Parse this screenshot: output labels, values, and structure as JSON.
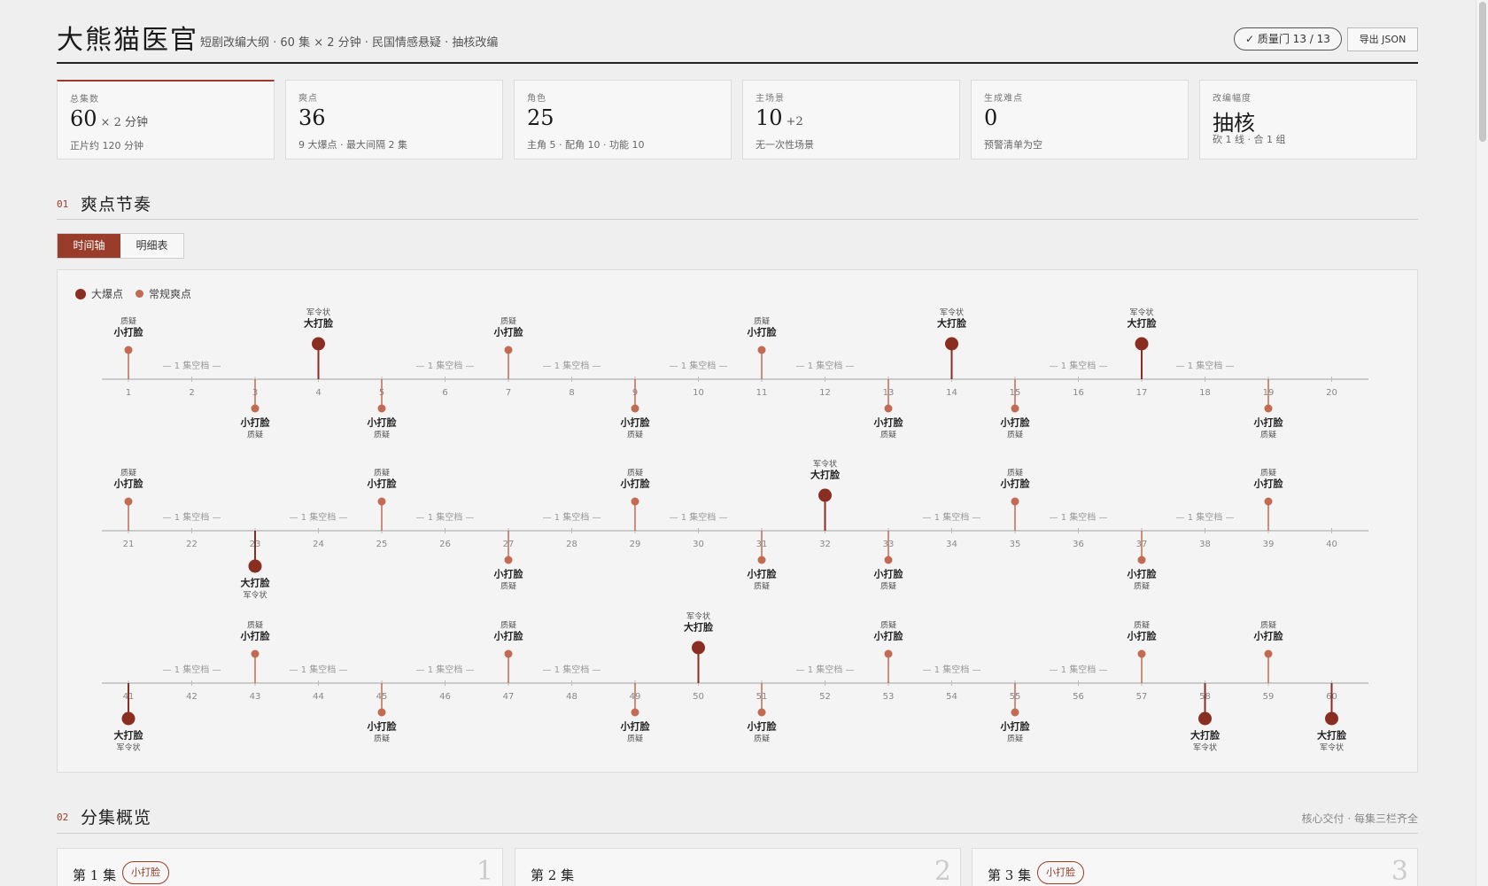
{
  "header": {
    "title": "大熊猫医官",
    "subtitle": "短剧改编大纲 · 60 集 × 2 分钟 · 民国情感悬疑 · 抽核改编",
    "quality_button": "✓ 质量门 13 / 13",
    "export_button": "导出 JSON"
  },
  "stats": [
    {
      "label": "总集数",
      "value": "60",
      "suffix": "× 2 分钟",
      "note": "正片约 120 分钟"
    },
    {
      "label": "爽点",
      "value": "36",
      "suffix": "",
      "note": "9 大爆点 · 最大间隔 2 集"
    },
    {
      "label": "角色",
      "value": "25",
      "suffix": "",
      "note": "主角 5 · 配角 10 · 功能 10"
    },
    {
      "label": "主场景",
      "value": "10",
      "suffix": "+2",
      "note": "无一次性场景"
    },
    {
      "label": "生成难点",
      "value": "0",
      "suffix": "",
      "note": "预警清单为空"
    },
    {
      "label": "改编幅度",
      "value": "抽核",
      "suffix": "",
      "note": "砍 1 线 · 合 1 组"
    }
  ],
  "section1": {
    "num": "01",
    "title": "爽点节奏"
  },
  "tabs": [
    "时间轴",
    "明细表"
  ],
  "legend": {
    "major": "大爆点",
    "regular": "常规爽点"
  },
  "gap_label": "— 1 集空档 —",
  "colors": {
    "accent": "#9a3c2a",
    "major": "#8b2e22",
    "regular": "#c26a52",
    "axis": "#bdbdbd"
  },
  "beats": [
    {
      "ep": 1,
      "type": "regular",
      "name": "小打脸",
      "tag": "质疑"
    },
    {
      "ep": 3,
      "type": "regular",
      "name": "小打脸",
      "tag": "质疑"
    },
    {
      "ep": 4,
      "type": "major",
      "name": "大打脸",
      "tag": "军令状"
    },
    {
      "ep": 5,
      "type": "regular",
      "name": "小打脸",
      "tag": "质疑"
    },
    {
      "ep": 7,
      "type": "regular",
      "name": "小打脸",
      "tag": "质疑"
    },
    {
      "ep": 9,
      "type": "regular",
      "name": "小打脸",
      "tag": "质疑"
    },
    {
      "ep": 11,
      "type": "regular",
      "name": "小打脸",
      "tag": "质疑"
    },
    {
      "ep": 13,
      "type": "regular",
      "name": "小打脸",
      "tag": "质疑"
    },
    {
      "ep": 14,
      "type": "major",
      "name": "大打脸",
      "tag": "军令状"
    },
    {
      "ep": 15,
      "type": "regular",
      "name": "小打脸",
      "tag": "质疑"
    },
    {
      "ep": 17,
      "type": "major",
      "name": "大打脸",
      "tag": "军令状"
    },
    {
      "ep": 19,
      "type": "regular",
      "name": "小打脸",
      "tag": "质疑"
    },
    {
      "ep": 21,
      "type": "regular",
      "name": "小打脸",
      "tag": "质疑"
    },
    {
      "ep": 23,
      "type": "major",
      "name": "大打脸",
      "tag": "军令状"
    },
    {
      "ep": 25,
      "type": "regular",
      "name": "小打脸",
      "tag": "质疑"
    },
    {
      "ep": 27,
      "type": "regular",
      "name": "小打脸",
      "tag": "质疑"
    },
    {
      "ep": 29,
      "type": "regular",
      "name": "小打脸",
      "tag": "质疑"
    },
    {
      "ep": 31,
      "type": "regular",
      "name": "小打脸",
      "tag": "质疑"
    },
    {
      "ep": 32,
      "type": "major",
      "name": "大打脸",
      "tag": "军令状"
    },
    {
      "ep": 33,
      "type": "regular",
      "name": "小打脸",
      "tag": "质疑"
    },
    {
      "ep": 35,
      "type": "regular",
      "name": "小打脸",
      "tag": "质疑"
    },
    {
      "ep": 37,
      "type": "regular",
      "name": "小打脸",
      "tag": "质疑"
    },
    {
      "ep": 39,
      "type": "regular",
      "name": "小打脸",
      "tag": "质疑"
    },
    {
      "ep": 41,
      "type": "major",
      "name": "大打脸",
      "tag": "军令状"
    },
    {
      "ep": 43,
      "type": "regular",
      "name": "小打脸",
      "tag": "质疑"
    },
    {
      "ep": 45,
      "type": "regular",
      "name": "小打脸",
      "tag": "质疑"
    },
    {
      "ep": 47,
      "type": "regular",
      "name": "小打脸",
      "tag": "质疑"
    },
    {
      "ep": 49,
      "type": "regular",
      "name": "小打脸",
      "tag": "质疑"
    },
    {
      "ep": 50,
      "type": "major",
      "name": "大打脸",
      "tag": "军令状"
    },
    {
      "ep": 51,
      "type": "regular",
      "name": "小打脸",
      "tag": "质疑"
    },
    {
      "ep": 53,
      "type": "regular",
      "name": "小打脸",
      "tag": "质疑"
    },
    {
      "ep": 55,
      "type": "regular",
      "name": "小打脸",
      "tag": "质疑"
    },
    {
      "ep": 57,
      "type": "regular",
      "name": "小打脸",
      "tag": "质疑"
    },
    {
      "ep": 58,
      "type": "major",
      "name": "大打脸",
      "tag": "军令状"
    },
    {
      "ep": 59,
      "type": "regular",
      "name": "小打脸",
      "tag": "质疑"
    },
    {
      "ep": 60,
      "type": "major",
      "name": "大打脸",
      "tag": "军令状"
    }
  ],
  "section2": {
    "num": "02",
    "title": "分集概览",
    "note": "核心交付 · 每集三栏齐全"
  },
  "episodes": [
    {
      "title": "第 1 集",
      "badge": "小打脸",
      "num": "1"
    },
    {
      "title": "第 2 集",
      "badge": "",
      "num": "2"
    },
    {
      "title": "第 3 集",
      "badge": "小打脸",
      "num": "3"
    }
  ]
}
